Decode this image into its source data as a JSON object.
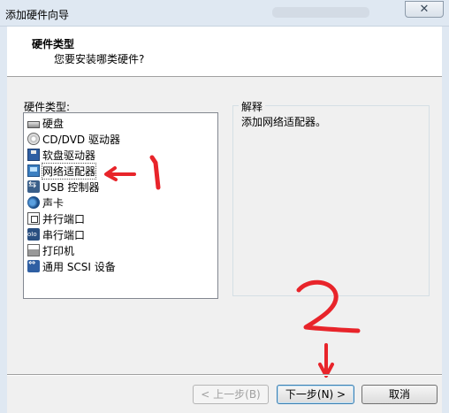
{
  "window": {
    "title": "添加硬件向导",
    "close_label": "✕"
  },
  "header": {
    "title": "硬件类型",
    "subtitle": "您要安装哪类硬件?"
  },
  "hardware": {
    "label": "硬件类型:",
    "items": [
      {
        "label": "硬盘",
        "icon": "hard-disk-icon"
      },
      {
        "label": "CD/DVD 驱动器",
        "icon": "cd-dvd-icon"
      },
      {
        "label": "软盘驱动器",
        "icon": "floppy-icon"
      },
      {
        "label": "网络适配器",
        "icon": "network-adapter-icon",
        "selected": true
      },
      {
        "label": "USB 控制器",
        "icon": "usb-icon"
      },
      {
        "label": "声卡",
        "icon": "sound-card-icon"
      },
      {
        "label": "并行端口",
        "icon": "parallel-port-icon"
      },
      {
        "label": "串行端口",
        "icon": "serial-port-icon"
      },
      {
        "label": "打印机",
        "icon": "printer-icon"
      },
      {
        "label": "通用 SCSI 设备",
        "icon": "scsi-icon"
      }
    ]
  },
  "description": {
    "label": "解释",
    "text": "添加网络适配器。"
  },
  "buttons": {
    "back": "< 上一步(B)",
    "next": "下一步(N) >",
    "cancel": "取消"
  },
  "annotations": {
    "color": "#e8242a"
  }
}
